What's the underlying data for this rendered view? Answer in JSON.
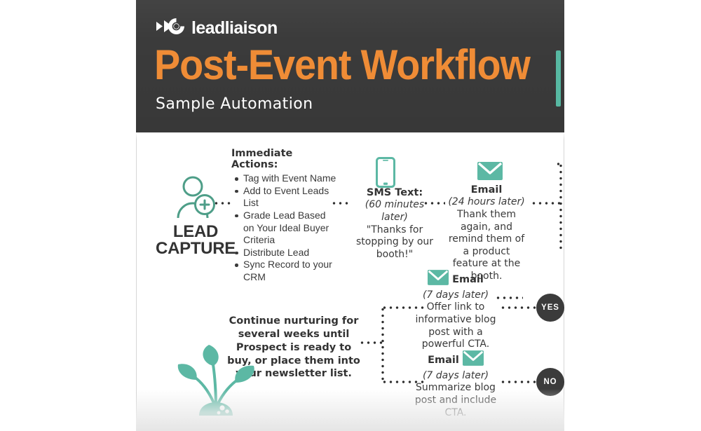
{
  "header": {
    "logo_icon": "leadliaison-logo-icon",
    "logo_word": "leadliaison",
    "title": "Post-Event Workflow",
    "subtitle": "Sample Automation",
    "bg_color": "#3b3b3b",
    "title_color": "#ef8c36",
    "accent_color": "#57b8a2"
  },
  "lead_capture": {
    "icon": "person-add-icon",
    "label_line1": "LEAD",
    "label_line2": "CAPTURE"
  },
  "immediate_actions": {
    "title": "Immediate Actions:",
    "items": [
      "Tag with Event Name",
      "Add to Event Leads List",
      "Grade Lead Based on Your Ideal Buyer Criteria",
      "Distribute Lead",
      "Sync Record to your CRM"
    ]
  },
  "nodes": {
    "sms": {
      "icon": "smartphone-icon",
      "title": "SMS Text:",
      "timing": "(60 minutes later)",
      "body": "\"Thanks for stopping by our booth!\""
    },
    "email_24h": {
      "icon": "envelope-icon",
      "title": "Email",
      "timing": "(24 hours later)",
      "body": "Thank them again, and remind them of a product feature at the booth."
    },
    "email_7d_yes": {
      "icon": "envelope-icon",
      "title": "Email",
      "timing": "(7 days later)",
      "body": "Offer link to informative blog post with a powerful CTA."
    },
    "email_7d_no": {
      "icon": "envelope-icon",
      "title": "Email",
      "timing": "(7 days later)",
      "body": "Summarize blog post and include CTA."
    }
  },
  "nurture": {
    "icon": "seedling-plant-icon",
    "text": "Continue nurturing for several weeks until Prospect is ready to buy, or place them into your newsletter list."
  },
  "decisions": {
    "yes_label": "YES",
    "no_label": "NO",
    "badge_color": "#3b3b3b"
  },
  "colors": {
    "teal": "#5cb8a4",
    "dark": "#3b3b3b",
    "orange": "#ef8c36",
    "text": "#3a3a3a"
  }
}
